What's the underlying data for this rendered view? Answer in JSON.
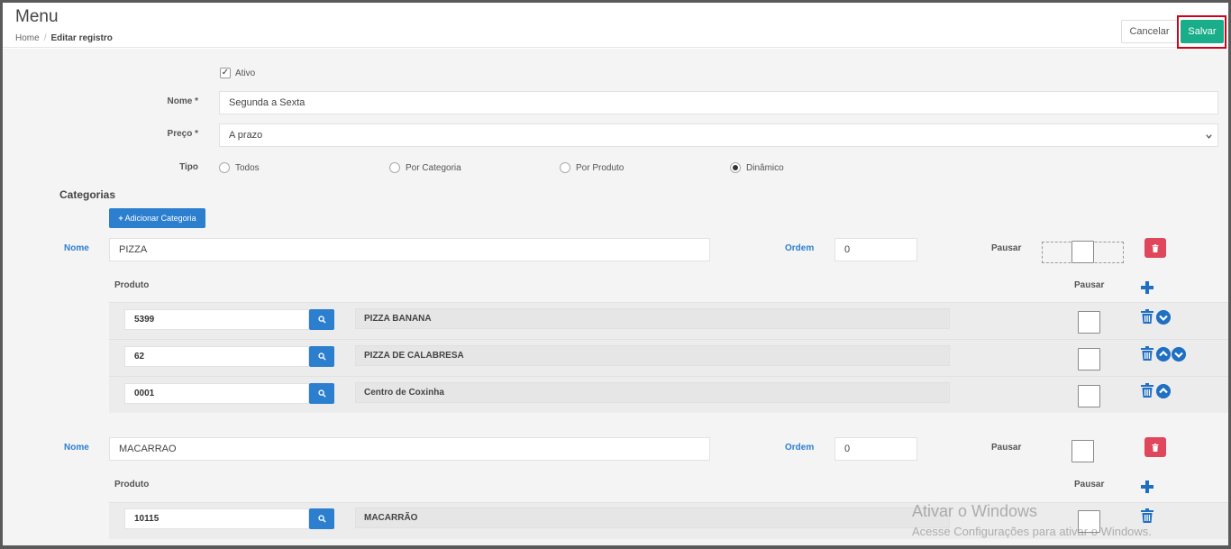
{
  "header": {
    "title": "Menu",
    "breadcrumb": {
      "home": "Home",
      "separator": "/",
      "current": "Editar registro"
    },
    "cancel_label": "Cancelar",
    "save_label": "Salvar"
  },
  "form": {
    "ativo_label": "Ativo",
    "ativo_checked": true,
    "nome_label": "Nome *",
    "nome_value": "Segunda a Sexta",
    "preco_label": "Preço *",
    "preco_value": "A prazo",
    "tipo_label": "Tipo",
    "tipo_options": [
      "Todos",
      "Por Categoria",
      "Por Produto",
      "Dinâmico"
    ],
    "tipo_selected": "Dinâmico"
  },
  "categorias": {
    "title": "Categorias",
    "add_button": "Adicionar Categoria",
    "nome_label": "Nome",
    "ordem_label": "Ordem",
    "pausar_label": "Pausar",
    "produto_label": "Produto",
    "items": [
      {
        "nome": "PIZZA",
        "ordem": "0",
        "produtos": [
          {
            "codigo": "5399",
            "nome": "PIZZA BANANA",
            "actions": [
              "delete-icon",
              "chevron-down-icon"
            ]
          },
          {
            "codigo": "62",
            "nome": "PIZZA DE CALABRESA",
            "actions": [
              "delete-icon",
              "chevron-up-icon",
              "chevron-down-icon"
            ]
          },
          {
            "codigo": "0001",
            "nome": "Centro de Coxinha",
            "actions": [
              "delete-icon",
              "chevron-up-icon"
            ]
          }
        ]
      },
      {
        "nome": "MACARRAO",
        "ordem": "0",
        "produtos": [
          {
            "codigo": "10115",
            "nome": "MACARRÃO",
            "actions": [
              "delete-icon"
            ]
          }
        ]
      }
    ]
  },
  "watermark": {
    "line1": "Ativar o Windows",
    "line2": "Acesse Configurações para ativar o Windows."
  },
  "colors": {
    "save": "#1aad8a",
    "primary": "#2c7fcf",
    "danger": "#e0475c",
    "highlight_border": "#d0021b"
  }
}
